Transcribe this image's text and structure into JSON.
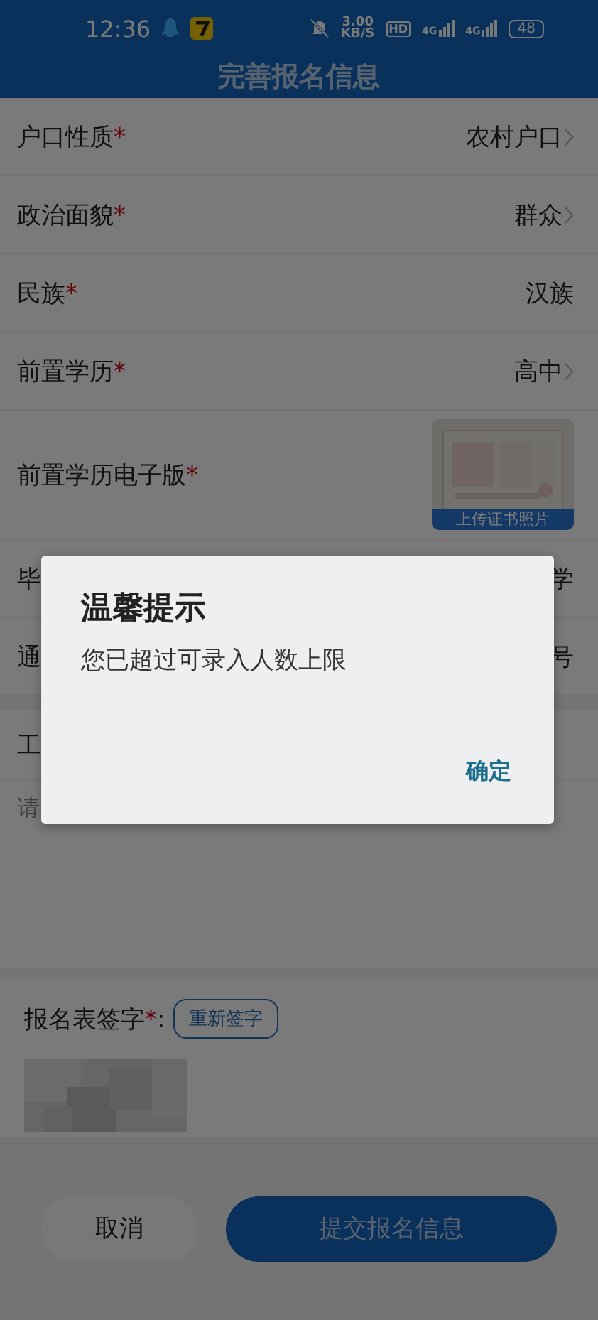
{
  "status_bar": {
    "time": "12:36",
    "speed": "3.00",
    "speed_unit": "KB/S",
    "hd": "HD",
    "networks": [
      "4G",
      "4G"
    ],
    "battery": "48"
  },
  "header": {
    "title": "完善报名信息"
  },
  "fields": [
    {
      "kind": "select",
      "label": "户口性质",
      "mark": "*",
      "value": "农村户口"
    },
    {
      "kind": "select",
      "label": "政治面貌",
      "mark": "*",
      "value": "群众"
    },
    {
      "kind": "text",
      "label": "民族",
      "mark": "*",
      "value": "汉族"
    },
    {
      "kind": "select",
      "label": "前置学历",
      "mark": "*",
      "value": "高中"
    },
    {
      "kind": "upload",
      "label": "前置学历电子版",
      "mark": "*",
      "upload_label": "上传证书照片"
    },
    {
      "kind": "text",
      "label": "毕",
      "value": "学"
    },
    {
      "kind": "text",
      "label": "通",
      "value": "号"
    }
  ],
  "work": {
    "label": "工",
    "placeholder": "请"
  },
  "signature": {
    "label": "报名表签字",
    "mark": "*",
    "colon": ":",
    "button": "重新签字"
  },
  "actions": {
    "cancel": "取消",
    "submit": "提交报名信息"
  },
  "dialog": {
    "title": "温馨提示",
    "message": "您已超过可录入人数上限",
    "confirm": "确定"
  }
}
